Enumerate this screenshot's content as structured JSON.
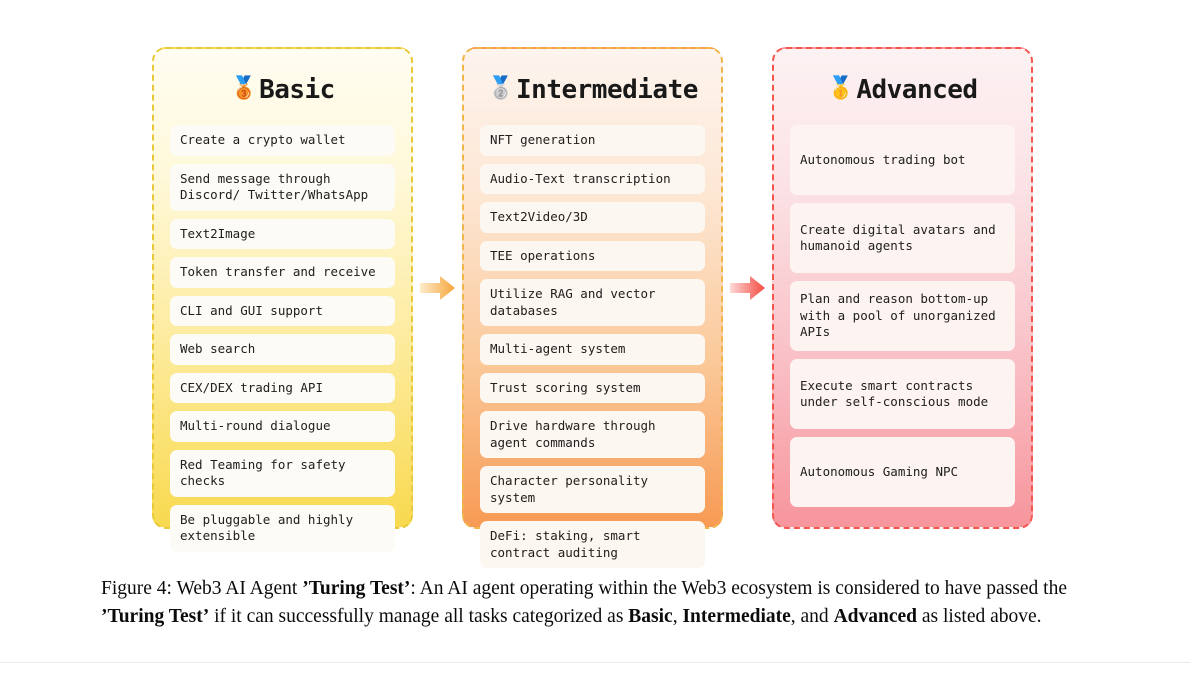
{
  "figure": {
    "columns": [
      {
        "id": "basic",
        "title": "Basic",
        "medal": "🥉",
        "medal_icon_name": "bronze-medal-icon",
        "border_color": "#e8c93a",
        "items": [
          "Create a crypto wallet",
          "Send message through Discord/ Twitter/WhatsApp",
          "Text2Image",
          "Token transfer and receive",
          "CLI and GUI support",
          "Web search",
          "CEX/DEX trading API",
          "Multi-round dialogue",
          "Red Teaming for safety checks",
          "Be pluggable and highly extensible"
        ]
      },
      {
        "id": "intermediate",
        "title": "Intermediate",
        "medal": "🥈",
        "medal_icon_name": "silver-medal-icon",
        "border_color": "#f0b64a",
        "items": [
          "NFT generation",
          "Audio-Text transcription",
          "Text2Video/3D",
          "TEE operations",
          "Utilize RAG and vector databases",
          "Multi-agent system",
          "Trust scoring system",
          "Drive hardware through agent commands",
          "Character personality system",
          "DeFi: staking, smart contract auditing"
        ]
      },
      {
        "id": "advanced",
        "title": "Advanced",
        "medal": "🥇",
        "medal_icon_name": "gold-medal-icon",
        "border_color": "#f4564e",
        "items": [
          "Autonomous trading bot",
          "Create digital avatars and humanoid agents",
          "Plan and reason bottom-up with a pool of unorganized APIs",
          "Execute smart contracts under self-conscious mode",
          "Autonomous Gaming NPC"
        ]
      }
    ],
    "arrows": [
      {
        "name": "arrow-basic-to-intermediate",
        "color_start": "#fde7bd",
        "color_end": "#f6a63c"
      },
      {
        "name": "arrow-intermediate-to-advanced",
        "color_start": "#fbd2cf",
        "color_end": "#f3483f"
      }
    ]
  },
  "caption": {
    "label": "Figure 4:",
    "part1": " Web3 AI Agent ",
    "bold1": "’Turing Test’",
    "part2": ": An AI agent operating within the Web3 ecosystem is considered to have passed the ",
    "bold2": "’Turing Test’",
    "part3": " if it can successfully manage all tasks categorized as ",
    "bold3": "Basic",
    "part4": ", ",
    "bold4": "Intermediate",
    "part5": ", and ",
    "bold5": "Advanced",
    "part6": " as listed above."
  }
}
